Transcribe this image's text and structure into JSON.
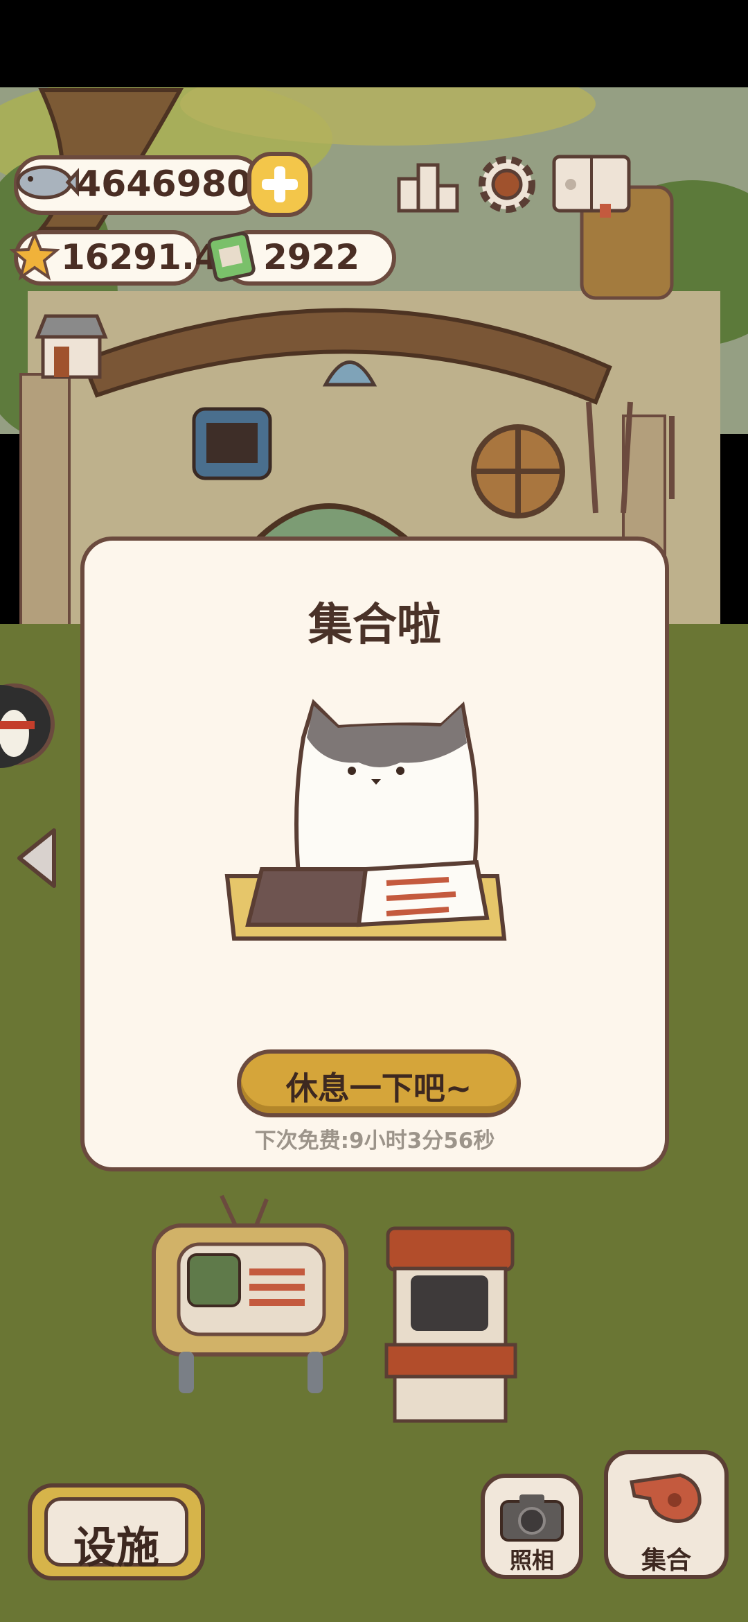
{
  "currency": {
    "fish": "4646980",
    "stars": "16291.4",
    "cans": "2922"
  },
  "icons": {
    "fish": "fish-icon",
    "add": "plus-icon",
    "star": "star-icon",
    "can": "can-icon",
    "ranking": "ranking-icon",
    "settings": "gear-icon",
    "book": "paw-book-icon",
    "shop": "shop-icon",
    "back": "left-arrow-icon",
    "avatar": "penguin-avatar-icon",
    "camera": "camera-icon",
    "whistle": "whistle-icon"
  },
  "modal": {
    "title": "集合啦",
    "button_label": "休息一下吧~",
    "cooldown": "下次免费:9小时3分56秒"
  },
  "bottom_bar": {
    "facilities_label": "设施",
    "photo_label": "照相",
    "gather_label": "集合"
  },
  "colors": {
    "outline": "#6b4a3e",
    "gold_button": "#d5a53a",
    "modal_bg": "#fdf6ec",
    "grass": "#6b7a35"
  }
}
